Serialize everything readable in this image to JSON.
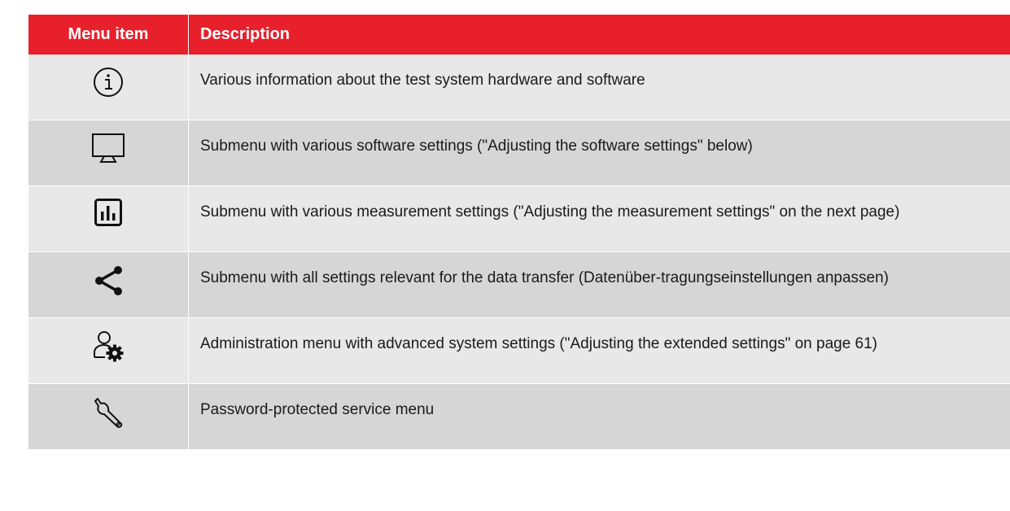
{
  "header": {
    "col1": "Menu item",
    "col2": "Description"
  },
  "rows": [
    {
      "icon": "info-icon",
      "description": "Various information about the test system hardware and software"
    },
    {
      "icon": "monitor-icon",
      "description": "Submenu with various software settings (\"Adjusting the software settings\" below)"
    },
    {
      "icon": "bar-chart-icon",
      "description": "Submenu with various measurement settings (\"Adjusting the measurement settings\" on the next page)"
    },
    {
      "icon": "share-icon",
      "description": "Submenu with all settings relevant for the data transfer (Datenüber-tragungseinstellungen anpassen)"
    },
    {
      "icon": "user-settings-icon",
      "description": "Administration menu with advanced system settings (\"Adjusting the extended settings\" on page 61)"
    },
    {
      "icon": "wrench-icon",
      "description": "Password-protected service menu"
    }
  ],
  "colors": {
    "header_bg": "#e8202c",
    "row_odd": "#e8e8e8",
    "row_even": "#d6d6d6"
  }
}
